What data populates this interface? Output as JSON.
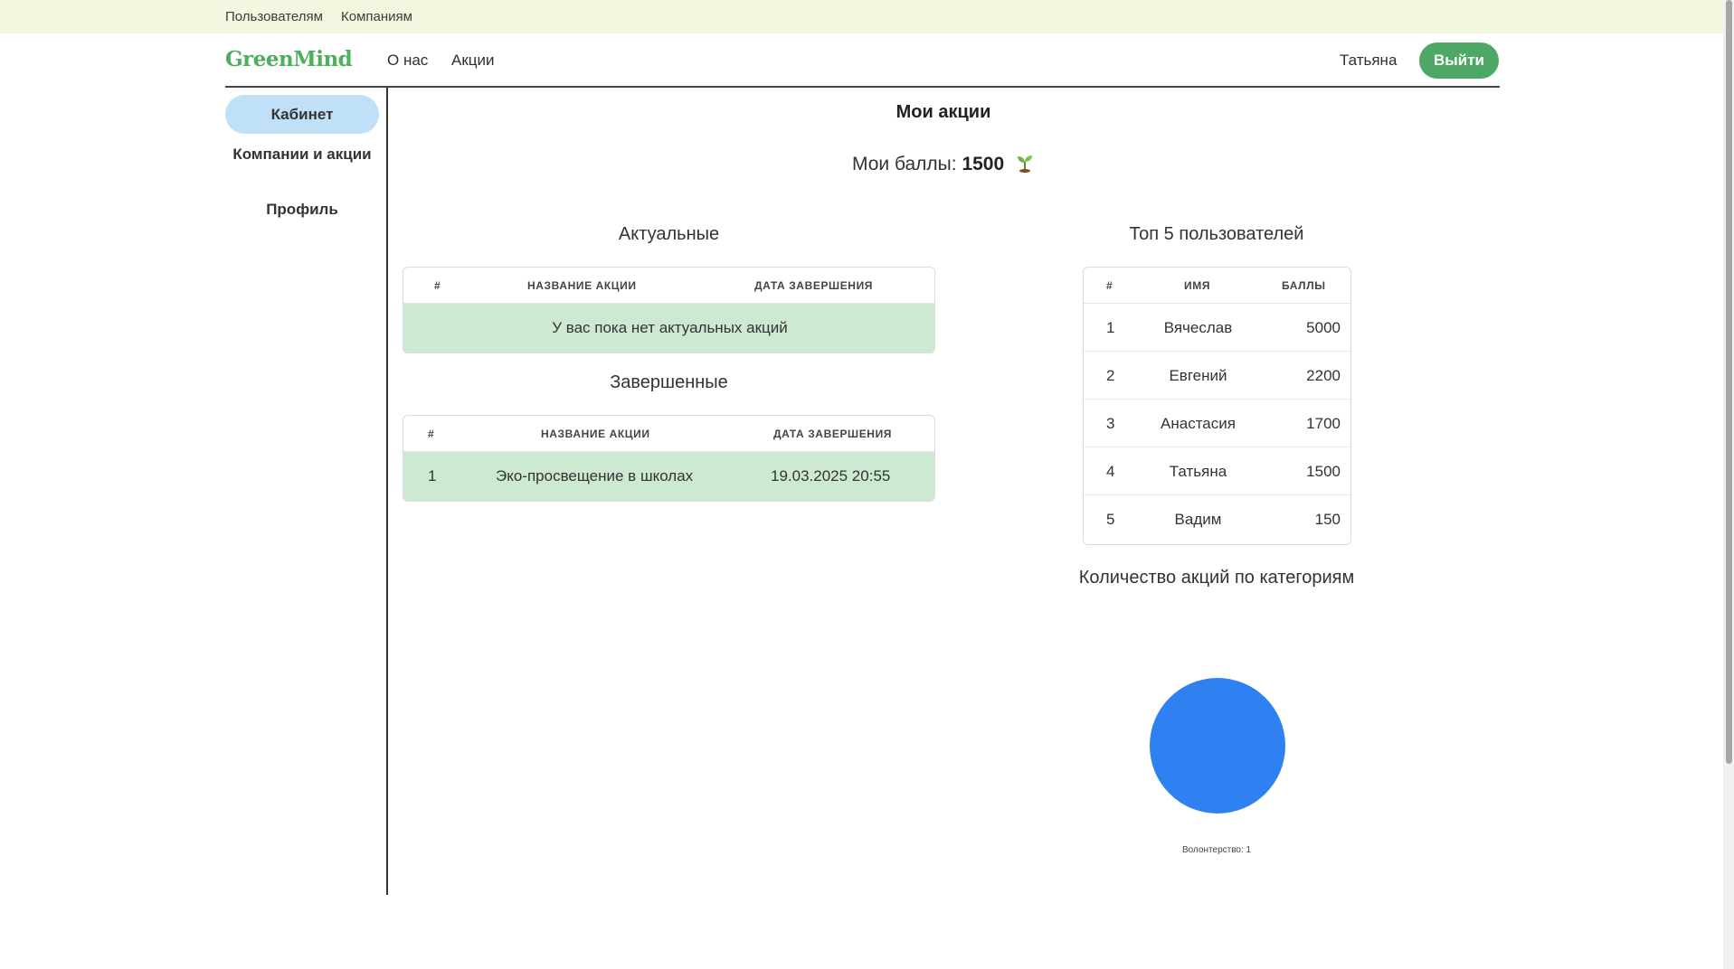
{
  "top_links": {
    "users": "Пользователям",
    "companies": "Компаниям"
  },
  "header": {
    "logo": "GreenMind",
    "nav": {
      "about": "О нас",
      "actions": "Акции"
    },
    "username": "Татьяна",
    "logout_label": "Выйти"
  },
  "sidebar": {
    "items": [
      {
        "label": "Кабинет",
        "active": true
      },
      {
        "label": "Компании и акции"
      },
      {
        "label": "Профиль"
      }
    ]
  },
  "main": {
    "title": "Мои акции",
    "points_label": "Мои баллы:",
    "points_value": "1500",
    "current": {
      "title": "Актуальные",
      "columns": [
        "#",
        "Название акции",
        "Дата завершения"
      ],
      "empty_text": "У вас пока нет актуальных акций"
    },
    "completed": {
      "title": "Завершенные",
      "columns": [
        "#",
        "Название акции",
        "Дата завершения"
      ],
      "rows": [
        {
          "num": "1",
          "name": "Эко-просвещение в школах",
          "date": "19.03.2025 20:55"
        }
      ]
    },
    "top": {
      "title": "Топ 5 пользователей",
      "columns": [
        "#",
        "Имя",
        "Баллы"
      ],
      "rows": [
        {
          "num": "1",
          "name": "Вячеслав",
          "score": "5000"
        },
        {
          "num": "2",
          "name": "Евгений",
          "score": "2200"
        },
        {
          "num": "3",
          "name": "Анастасия",
          "score": "1700"
        },
        {
          "num": "4",
          "name": "Татьяна",
          "score": "1500"
        },
        {
          "num": "5",
          "name": "Вадим",
          "score": "150"
        }
      ]
    },
    "category_chart_title": "Количество акций по категориям"
  },
  "colors": {
    "brand_green": "#4caf5c",
    "button_green": "#4ea865",
    "active_sidebar": "#bfe0f6",
    "row_green": "#cde9d2",
    "pie_blue": "#2f80f0"
  },
  "chart_data": {
    "type": "pie",
    "categories": [
      "Волонтерство"
    ],
    "values": [
      1
    ],
    "legend_labels": [
      "Волонтерство: 1"
    ],
    "colors": [
      "#2f80f0"
    ],
    "legend_position": "bottom"
  }
}
